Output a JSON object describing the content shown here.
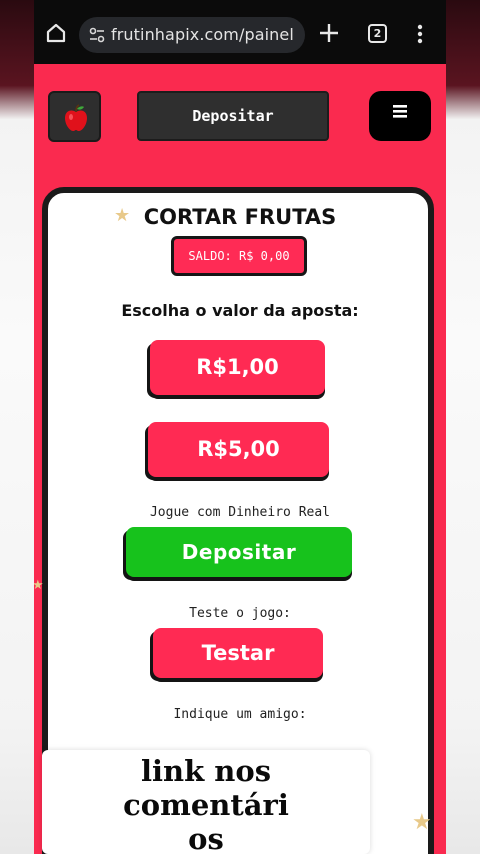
{
  "browser": {
    "url": "frutinhapix.com/painel",
    "tab_count": "2",
    "icons": [
      "home-icon",
      "site-settings-icon",
      "new-tab-plus-icon",
      "tab-switcher-icon",
      "more-vert-icon"
    ]
  },
  "header": {
    "logo_icon": "apple-icon",
    "deposit_label": "Depositar",
    "menu_icon": "hamburger-icon"
  },
  "main": {
    "title": "CORTAR FRUTAS",
    "balance": "SALDO: R$ 0,00",
    "bet_prompt": "Escolha o valor da aposta:",
    "bet_options": [
      "R$1,00",
      "R$5,00"
    ],
    "real_money_text": "Jogue com Dinheiro Real",
    "deposit_button": "Depositar",
    "test_text": "Teste o jogo:",
    "test_button": "Testar",
    "invite_text": "Indique um amigo:"
  },
  "overlay": {
    "caption": "link nos\ncomentári\nos"
  },
  "colors": {
    "accent_red": "#fa2a4f",
    "button_red": "#ff2a53",
    "deposit_green": "#17c21c",
    "dark": "#2f2f2f"
  }
}
